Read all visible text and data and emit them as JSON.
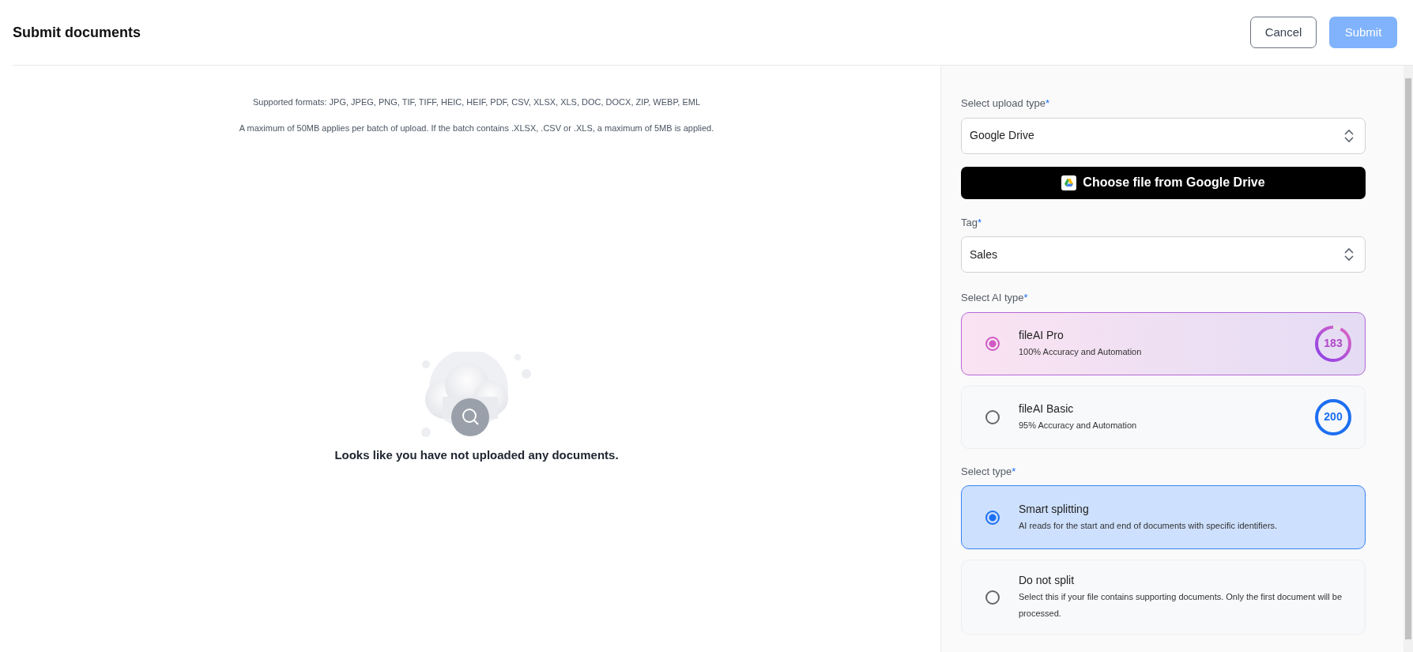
{
  "header": {
    "title": "Submit documents",
    "buttons": [
      {
        "label": "Cancel",
        "kind": "secondary"
      },
      {
        "label": "Submit",
        "kind": "primary",
        "disabled": true
      }
    ]
  },
  "upload_area": {
    "formats": "Supported formats: JPG, JPEG, PNG, TIF, TIFF, HEIC, HEIF, PDF, CSV, XLSX, XLS, DOC, DOCX, ZIP, WEBP, EML",
    "limit": "A maximum of 50MB applies per batch of upload. If the batch contains .XLSX, .CSV or .XLS, a maximum of 5MB is applied.",
    "empty_message": "Looks like you have not uploaded any documents."
  },
  "panel": {
    "upload_type": {
      "label": "Select upload type",
      "required_mark": "*",
      "value": "Google Drive"
    },
    "drive_button": {
      "label": "Choose file from Google Drive"
    },
    "tag": {
      "label": "Tag",
      "required_mark": "*",
      "value": "Sales"
    },
    "ai_type": {
      "label": "Select AI type",
      "required_mark": "*",
      "options": [
        {
          "kind": "pro",
          "title": "fileAI Pro",
          "description": "100% Accuracy and Automation",
          "count": "183",
          "level": 0.92,
          "selected": true
        },
        {
          "kind": "basic",
          "title": "fileAI Basic",
          "description": "95% Accuracy and Automation",
          "count": "200",
          "level": 1,
          "selected": false
        }
      ]
    },
    "split_type": {
      "label": "Select type",
      "required_mark": "*",
      "options": [
        {
          "title": "Smart splitting",
          "description": "AI reads for the start and end of documents with specific identifiers.",
          "selected": true
        },
        {
          "title": "Do not split",
          "description": "Select this if your file contains supporting documents. Only the first document will be processed.",
          "selected": false
        }
      ]
    }
  }
}
